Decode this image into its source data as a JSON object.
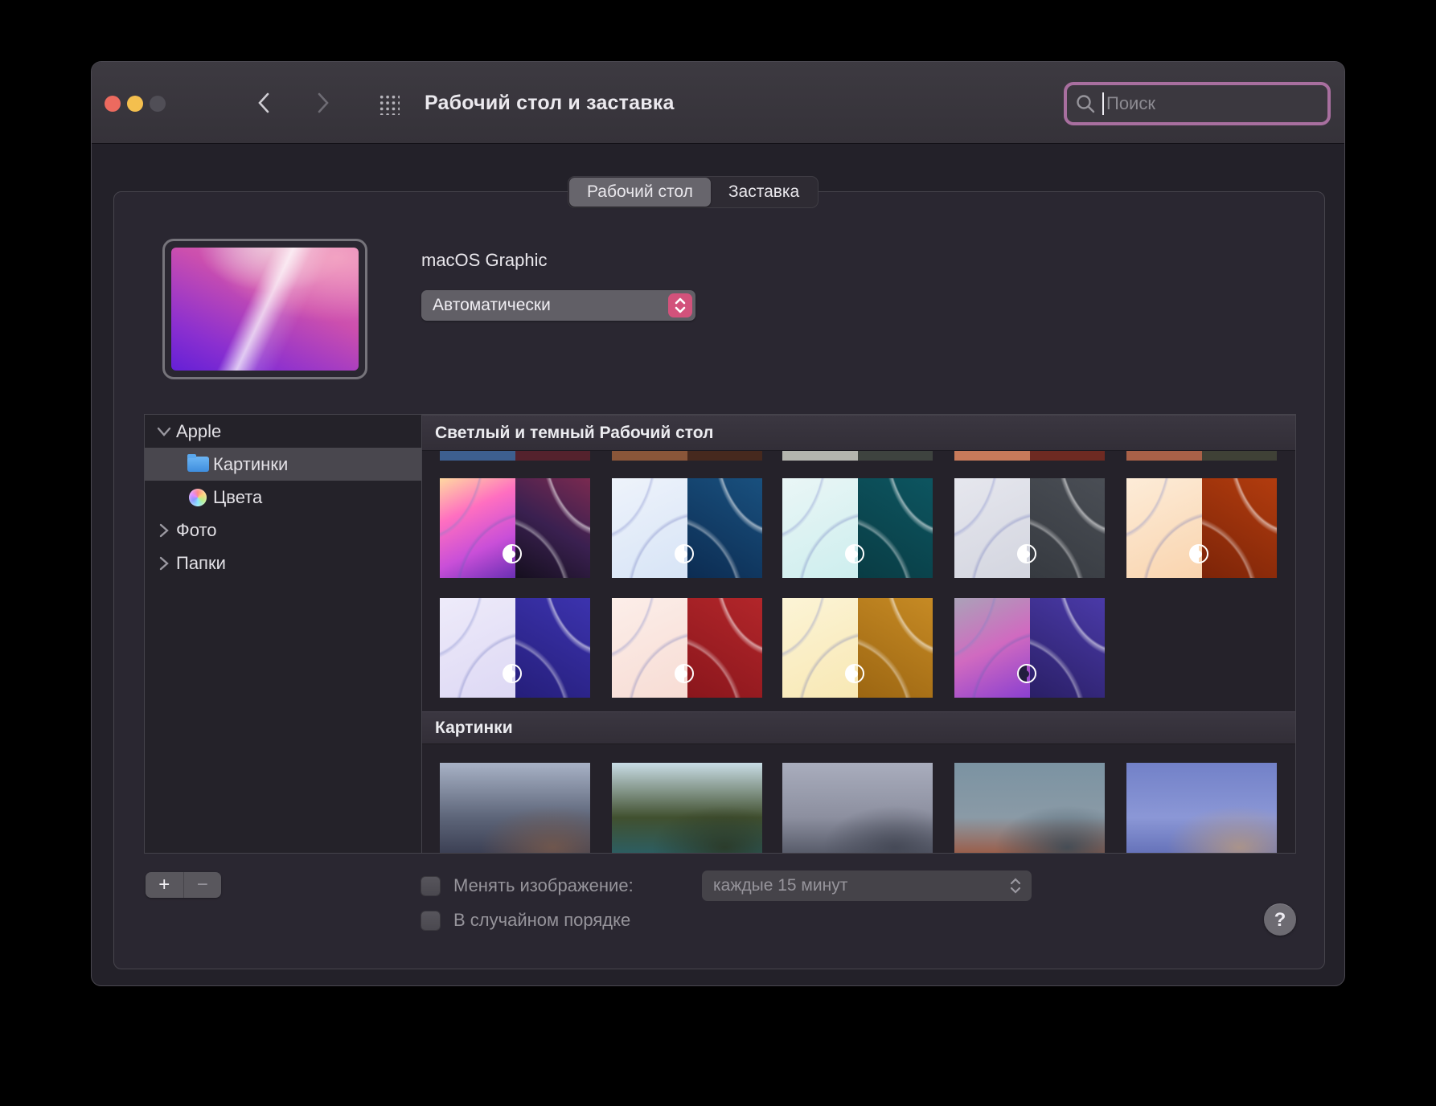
{
  "window": {
    "title": "Рабочий стол и заставка",
    "traffic_lights": {
      "close": "#ec6a5f",
      "minimize": "#f4bf4e",
      "zoom_inactive": "#504e56"
    }
  },
  "search": {
    "placeholder": "Поиск",
    "focus_ring_color": "#a86f9f"
  },
  "tabs": [
    {
      "label": "Рабочий стол",
      "selected": true
    },
    {
      "label": "Заставка",
      "selected": false
    }
  ],
  "preview": {
    "name": "macOS Graphic",
    "mode_select": "Автоматически",
    "stepper_color": "#d2527b"
  },
  "sidebar": {
    "selection_color": "#49474e",
    "rows": [
      {
        "label": "Apple",
        "type": "group",
        "expanded": true
      },
      {
        "label": "Картинки",
        "type": "child",
        "icon": "folder",
        "selected": true
      },
      {
        "label": "Цвета",
        "type": "child",
        "icon": "colors",
        "selected": false
      },
      {
        "label": "Фото",
        "type": "group",
        "expanded": false
      },
      {
        "label": "Папки",
        "type": "group",
        "expanded": false
      }
    ]
  },
  "wallpapers": {
    "section1_title": "Светлый и темный Рабочий стол",
    "section2_title": "Картинки",
    "cut_row": [
      {
        "left": "#3d5f8f",
        "right": "#54222d"
      },
      {
        "left": "#8a5639",
        "right": "#46291e"
      },
      {
        "left": "#b4b5ae",
        "right": "#3e433f"
      },
      {
        "left": "#c77a5a",
        "right": "#6e2a22"
      },
      {
        "left": "#a96148",
        "right": "#3f4136"
      }
    ],
    "row1": [
      {
        "name": "imac-abstract",
        "left": [
          "#ffd9a0",
          "#ff6fc0",
          "#c94fd8",
          "#6a2fb4"
        ],
        "right": [
          "#7a2a50",
          "#3a2050",
          "#150f1e"
        ],
        "badge": "normal"
      },
      {
        "name": "imac-blue",
        "left": [
          "#eef3fb",
          "#d7e4f6"
        ],
        "right": [
          "#19507e",
          "#0c2c52"
        ],
        "badge": "normal"
      },
      {
        "name": "imac-teal",
        "left": [
          "#eaf6f6",
          "#cdeeee"
        ],
        "right": [
          "#0d5560",
          "#093c44"
        ],
        "badge": "normal"
      },
      {
        "name": "imac-silver",
        "left": [
          "#e6e7ee",
          "#d3d5df"
        ],
        "right": [
          "#4a4e55",
          "#363a40"
        ],
        "badge": "normal"
      },
      {
        "name": "imac-orange",
        "left": [
          "#fdecd8",
          "#f9d4ae"
        ],
        "right": [
          "#b23c0e",
          "#7c2408"
        ],
        "badge": "normal"
      }
    ],
    "row2": [
      {
        "name": "imac-purple",
        "left": [
          "#eeebfa",
          "#ddd8f4"
        ],
        "right": [
          "#3c33ae",
          "#251e7a"
        ],
        "badge": "normal"
      },
      {
        "name": "imac-red",
        "left": [
          "#fceee9",
          "#f7dcd4"
        ],
        "right": [
          "#b2262a",
          "#8a161c"
        ],
        "badge": "normal"
      },
      {
        "name": "imac-yellow",
        "left": [
          "#fcf4d6",
          "#f8e8b4"
        ],
        "right": [
          "#c68a24",
          "#9c6612"
        ],
        "badge": "normal"
      },
      {
        "name": "monterey",
        "left": [
          "#aaa2b8",
          "#d06ac0",
          "#8a3fd0"
        ],
        "right": [
          "#4a3aa8",
          "#2a1f66"
        ],
        "badge": "inverted"
      }
    ],
    "photos": [
      {
        "name": "misty-mountains",
        "g": [
          "#a8b2c6",
          "#5d6579",
          "#33364a"
        ],
        "shadow": "#7a5a4a"
      },
      {
        "name": "big-sur-coast",
        "g": [
          "#c9dde6",
          "#41502f",
          "#27616e"
        ],
        "shadow": "#2a3420"
      },
      {
        "name": "sea-stacks-long-exposure",
        "g": [
          "#a9adbd",
          "#8c8f9f",
          "#4a4e5c"
        ],
        "shadow": "#3f4350"
      },
      {
        "name": "red-cliff-coast",
        "g": [
          "#7b93a2",
          "#8a9aa6",
          "#9e4f33"
        ],
        "shadow": "#314654"
      },
      {
        "name": "blue-sea-rock",
        "g": [
          "#7281c8",
          "#8b97d6",
          "#5c69b2"
        ],
        "shadow": "#b99a7e"
      }
    ]
  },
  "bottom": {
    "add_label": "+",
    "remove_label": "−",
    "change_picture_label": "Менять изображение:",
    "interval_value": "каждые 15 минут",
    "random_order_label": "В случайном порядке",
    "help_label": "?"
  }
}
